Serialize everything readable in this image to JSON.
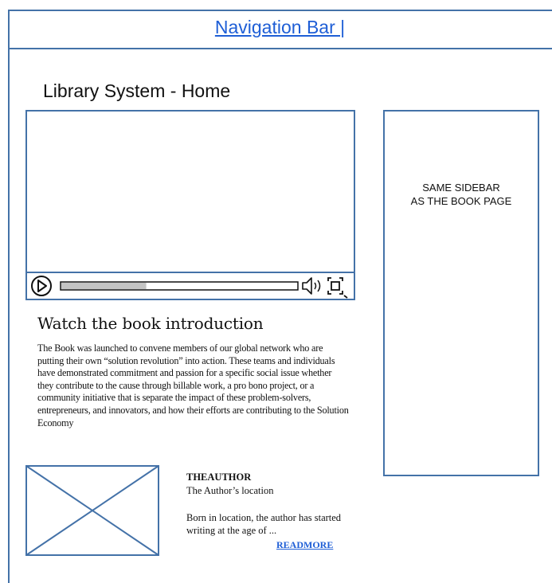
{
  "nav": {
    "label": "Navigation Bar |"
  },
  "page": {
    "title": "Library System - Home"
  },
  "video": {
    "progress": 0.36
  },
  "sidebar": {
    "text": "SAME SIDEBAR\nAS THE BOOK PAGE"
  },
  "intro": {
    "heading": "Watch the book introduction",
    "body": "The Book was launched to convene members of our global network who are putting their own “solution revolution” into action. These teams and individuals have demonstrated commitment and passion for a specific social issue whether they contribute to the cause through billable work, a pro bono project, or a community initiative that is separate the impact of these problem-solvers, entrepreneurs, and innovators, and how their efforts are contributing to the Solution Economy"
  },
  "author": {
    "name": "THEAUTHOR",
    "location": "The Author’s location",
    "bio": "Born in location, the author has started writing at the age of ...",
    "read_more": "READMORE"
  },
  "colors": {
    "accent": "#1e5ed6",
    "border": "#4472a8"
  }
}
